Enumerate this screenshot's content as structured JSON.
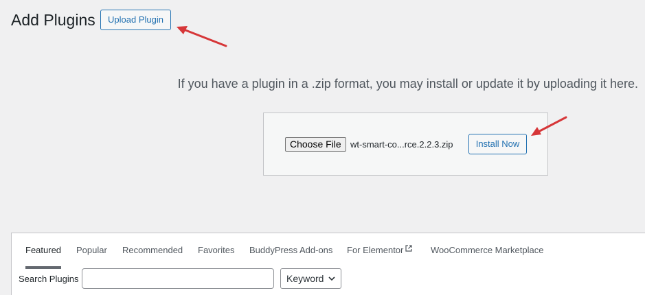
{
  "header": {
    "title": "Add Plugins",
    "upload_button": "Upload Plugin"
  },
  "upload": {
    "help_text": "If you have a plugin in a .zip format, you may install or update it by uploading it here.",
    "choose_file_label": "Choose File",
    "file_name": "wt-smart-co...rce.2.2.3.zip",
    "install_button": "Install Now"
  },
  "tabs": [
    {
      "label": "Featured",
      "current": true
    },
    {
      "label": "Popular"
    },
    {
      "label": "Recommended"
    },
    {
      "label": "Favorites"
    },
    {
      "label": "BuddyPress Add-ons"
    },
    {
      "label": "For Elementor",
      "icon": "external-link-icon"
    },
    {
      "label": "WooCommerce Marketplace"
    }
  ],
  "search": {
    "label": "Search Plugins",
    "value": "",
    "type_selected": "Keyword"
  },
  "colors": {
    "accent": "#2271b1",
    "annotation_arrow": "#d63638",
    "background": "#f0f0f1"
  }
}
